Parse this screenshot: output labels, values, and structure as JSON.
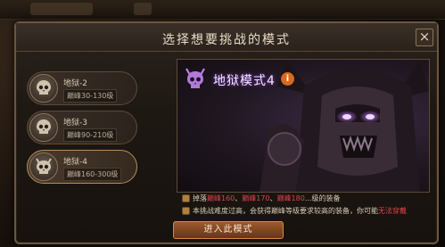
{
  "dialog": {
    "title": "选择想要挑战的模式",
    "close_label": "×"
  },
  "modes": [
    {
      "name": "地狱-2",
      "range": "巅峰30-130级",
      "selected": false
    },
    {
      "name": "地狱-3",
      "range": "巅峰90-210级",
      "selected": false
    },
    {
      "name": "地狱-4",
      "range": "巅峰160-300级",
      "selected": true
    }
  ],
  "selected_mode": {
    "title": "地狱模式4",
    "info_label": "i",
    "desc_drop_pre": "掉落",
    "desc_drop_hl1": "巅峰160",
    "desc_drop_sep1": "、",
    "desc_drop_hl2": "巅峰170",
    "desc_drop_sep2": "、",
    "desc_drop_hl3": "巅峰180",
    "desc_drop_post": "...级的装备",
    "desc_warn": "本挑战难度过高，会获得巅峰等级要求较高的装备，你可能",
    "desc_warn_hl": "无法穿戴"
  },
  "buttons": {
    "enter": "进入此模式"
  },
  "colors": {
    "accent_red": "#e0424a",
    "title_glow": "#8a3cd0",
    "button_bg": "#8a4a22"
  }
}
